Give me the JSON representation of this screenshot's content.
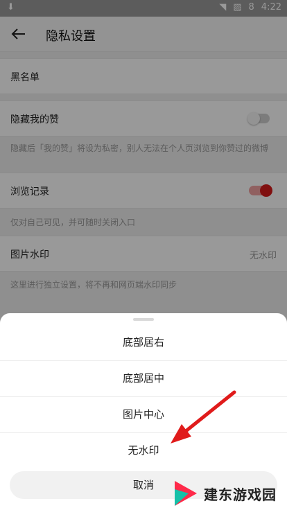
{
  "status": {
    "time": "4:22",
    "battery": "8"
  },
  "header": {
    "title": "隐私设置"
  },
  "settings": {
    "blacklist_label": "黑名单",
    "hide_likes_label": "隐藏我的赞",
    "hide_likes_hint": "隐藏后「我的赞」将设为私密，别人无法在个人页浏览到你赞过的微博",
    "history_label": "浏览记录",
    "history_hint": "仅对自己可见，并可随时关闭入口",
    "watermark_label": "图片水印",
    "watermark_value": "无水印",
    "watermark_hint": "这里进行独立设置，将不再和网页端水印同步"
  },
  "toggles": {
    "hide_likes": false,
    "history": true
  },
  "colors": {
    "accent": "#d61a1a",
    "overlay": "#000000",
    "arrow": "#e01b1b"
  },
  "sheet": {
    "options": [
      "底部居右",
      "底部居中",
      "图片中心",
      "无水印"
    ],
    "cancel_label": "取消"
  },
  "watermark_logo": {
    "text": "建东游戏园"
  }
}
